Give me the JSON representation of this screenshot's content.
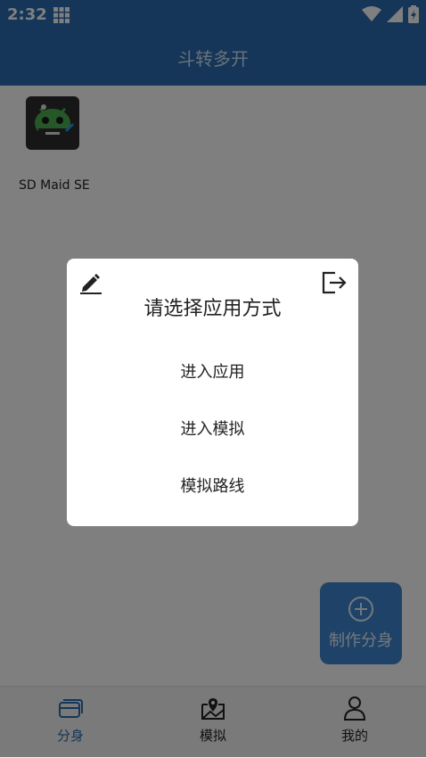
{
  "status": {
    "time": "2:32"
  },
  "appbar": {
    "title": "斗转多开"
  },
  "apps": [
    {
      "label": "SD Maid SE"
    }
  ],
  "fab": {
    "label": "制作分身"
  },
  "nav": [
    {
      "label": "分身",
      "color": "#2b6cb0"
    },
    {
      "label": "模拟",
      "color": "#222222"
    },
    {
      "label": "我的",
      "color": "#222222"
    }
  ],
  "dialog": {
    "title": "请选择应用方式",
    "options": [
      "进入应用",
      "进入模拟",
      "模拟路线"
    ]
  }
}
